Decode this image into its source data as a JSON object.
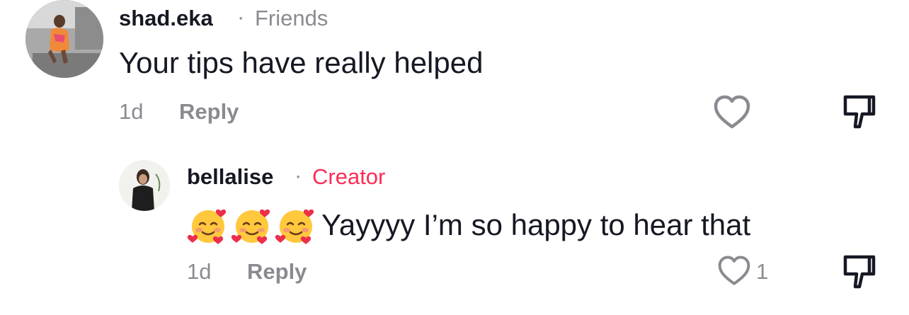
{
  "comments": [
    {
      "username": "shad.eka",
      "separator": "·",
      "tag": "Friends",
      "text": "Your tips have really helped",
      "time": "1d",
      "reply_label": "Reply",
      "like_count": "",
      "avatar_icon": "user-avatar-photo"
    },
    {
      "username": "bellalise",
      "separator": "·",
      "tag": "Creator",
      "emojis": [
        "smiling-face-with-hearts-icon",
        "smiling-face-with-hearts-icon",
        "smiling-face-with-hearts-icon"
      ],
      "text": "Yayyyy I’m so happy to hear that",
      "time": "1d",
      "reply_label": "Reply",
      "like_count": "1",
      "avatar_icon": "user-avatar-photo"
    }
  ],
  "colors": {
    "creator_tag": "#fe2c55",
    "muted": "#8a8b91",
    "text": "#161823"
  }
}
